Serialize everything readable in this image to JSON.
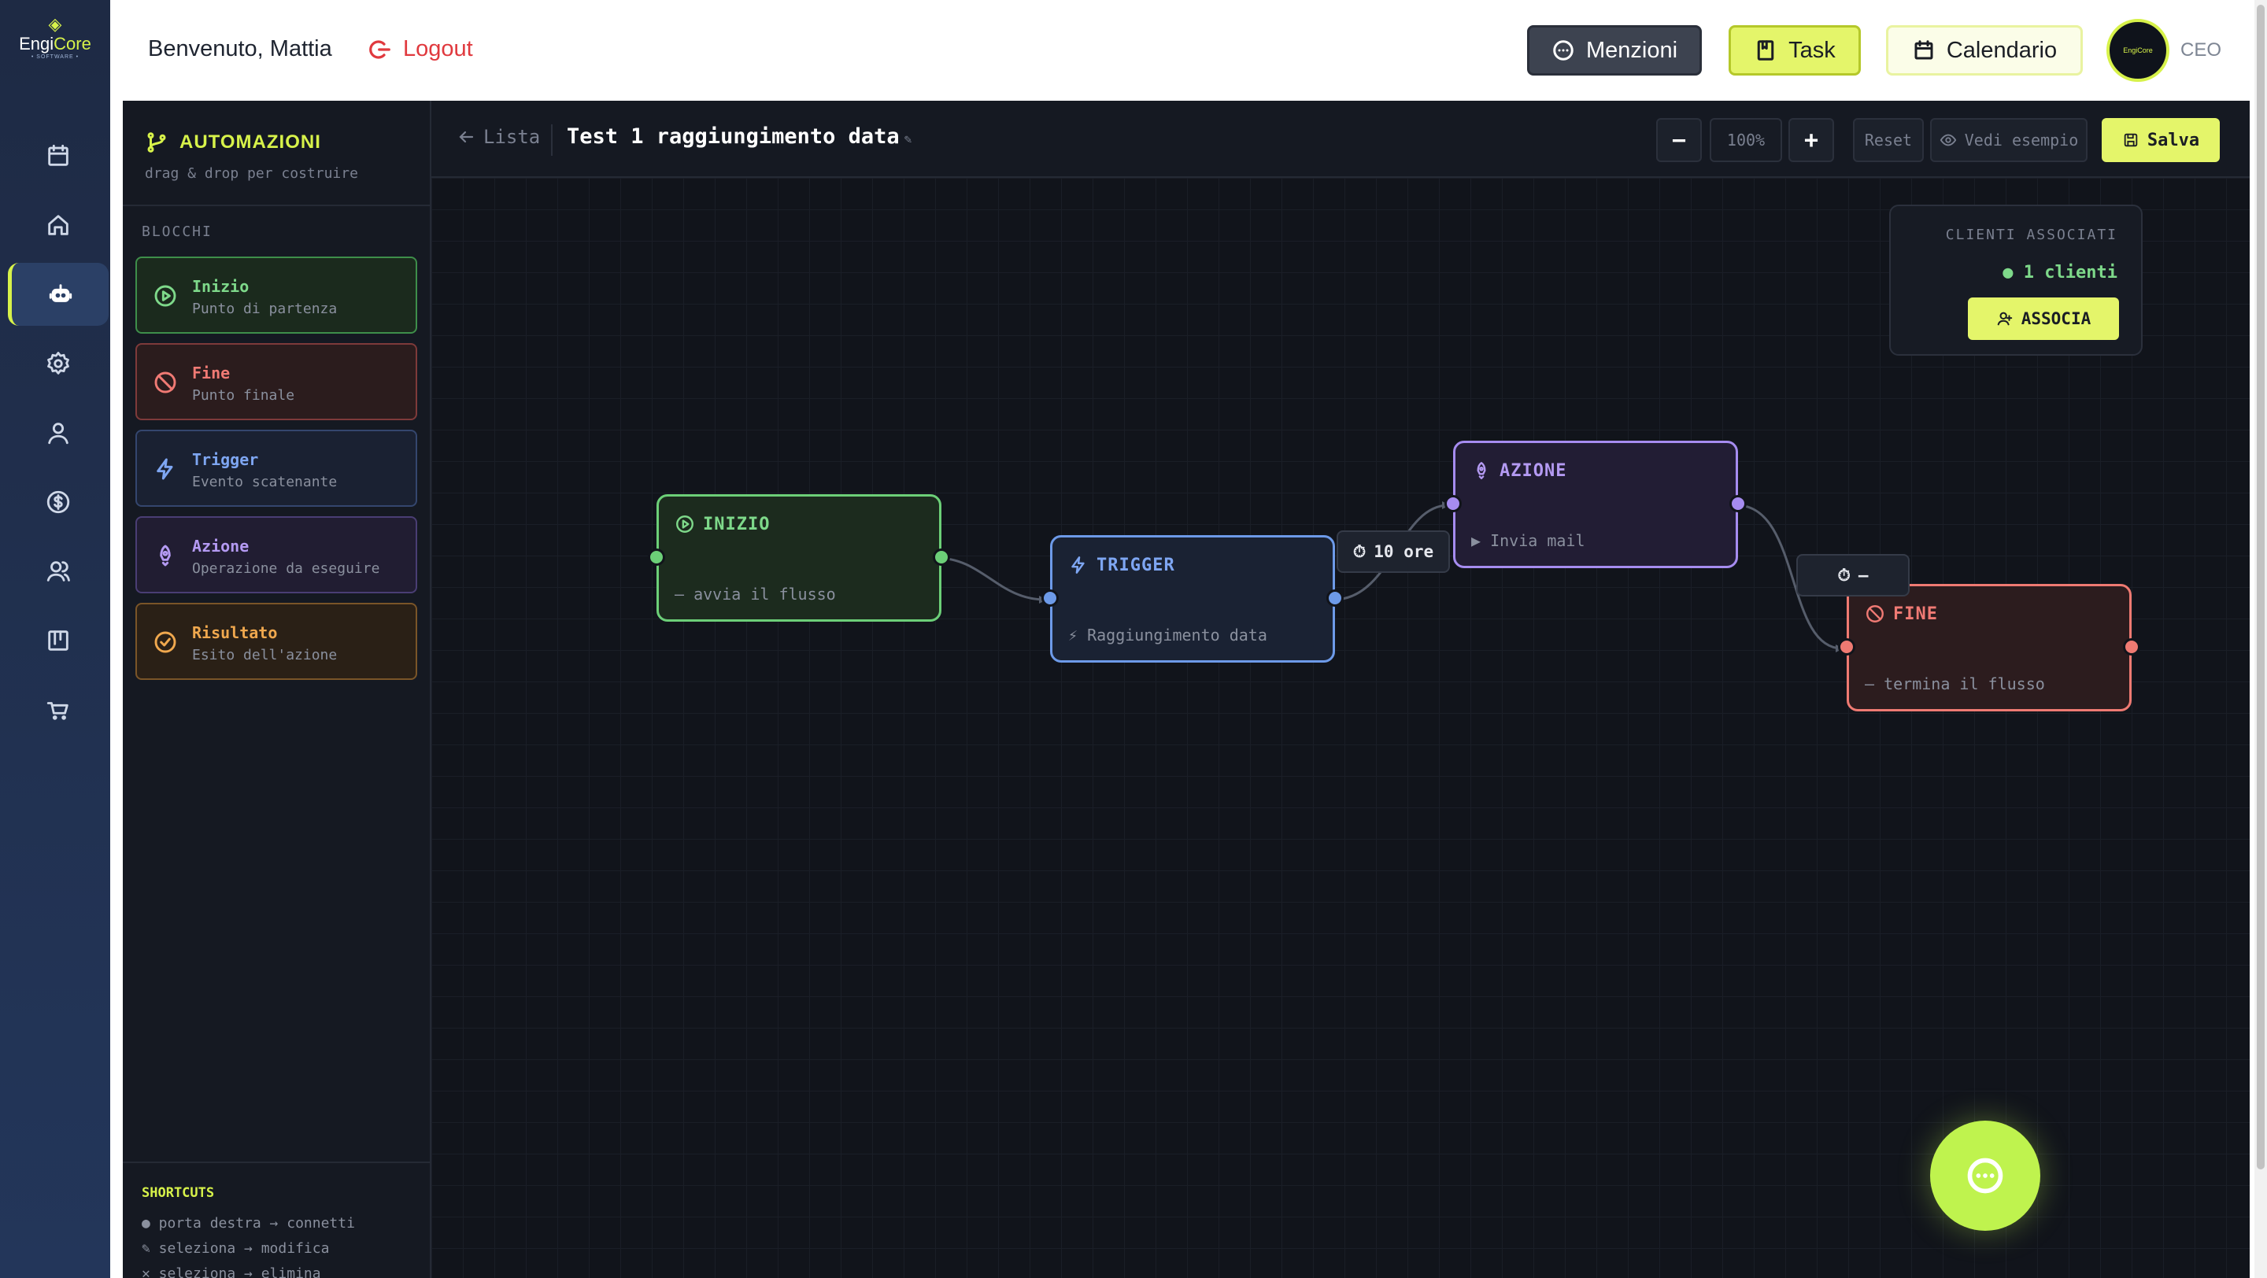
{
  "brand": {
    "name_left": "Engi",
    "name_right": "Core",
    "tagline": "• SOFTWARE •"
  },
  "header": {
    "welcome": "Benvenuto, Mattia",
    "logout": "Logout",
    "menzioni": "Menzioni",
    "task": "Task",
    "calendario": "Calendario",
    "avatar_text": "EngiCore",
    "role": "CEO"
  },
  "nav": {
    "items": [
      "calendar-icon",
      "home-icon",
      "robot-icon",
      "settings-icon",
      "user-icon",
      "dollar-icon",
      "users-icon",
      "board-icon",
      "cart-icon"
    ],
    "active": "robot-icon",
    "accent": "#d7f24a"
  },
  "sidebar": {
    "title": "AUTOMAZIONI",
    "subtitle": "drag & drop per costruire",
    "blocks_label": "BLOCCHI",
    "blocks": [
      {
        "name": "Inizio",
        "desc": "Punto di partenza"
      },
      {
        "name": "Fine",
        "desc": "Punto finale"
      },
      {
        "name": "Trigger",
        "desc": "Evento scatenante"
      },
      {
        "name": "Azione",
        "desc": "Operazione da eseguire"
      },
      {
        "name": "Risultato",
        "desc": "Esito dell'azione"
      }
    ],
    "shortcuts_title": "SHORTCUTS",
    "shortcuts": [
      "● porta destra → connetti",
      "✎ seleziona → modifica",
      "✕ seleziona → elimina"
    ]
  },
  "toolbar": {
    "back": "Lista",
    "flow_title": "Test 1 raggiungimento data",
    "edit_glyph": "✎",
    "zoom_out": "−",
    "zoom": "100%",
    "zoom_in": "+",
    "reset": "Reset",
    "example": "Vedi esempio",
    "save": "Salva"
  },
  "nodes": {
    "inizio": {
      "title": "INIZIO",
      "body": "— avvia il flusso",
      "color": "#6ccf78"
    },
    "trigger": {
      "title": "TRIGGER",
      "body": "⚡ Raggiungimento data",
      "color": "#6d9ae8"
    },
    "azione": {
      "title": "AZIONE",
      "body": "▶ Invia mail",
      "color": "#a68cf0"
    },
    "fine": {
      "title": "FINE",
      "body": "— termina il flusso",
      "color": "#ef7a72"
    }
  },
  "delays": {
    "d1": "10 ore",
    "d2": "—"
  },
  "clients": {
    "title": "CLIENTI ASSOCIATI",
    "count": "● 1 clienti",
    "button": "ASSOCIA"
  }
}
